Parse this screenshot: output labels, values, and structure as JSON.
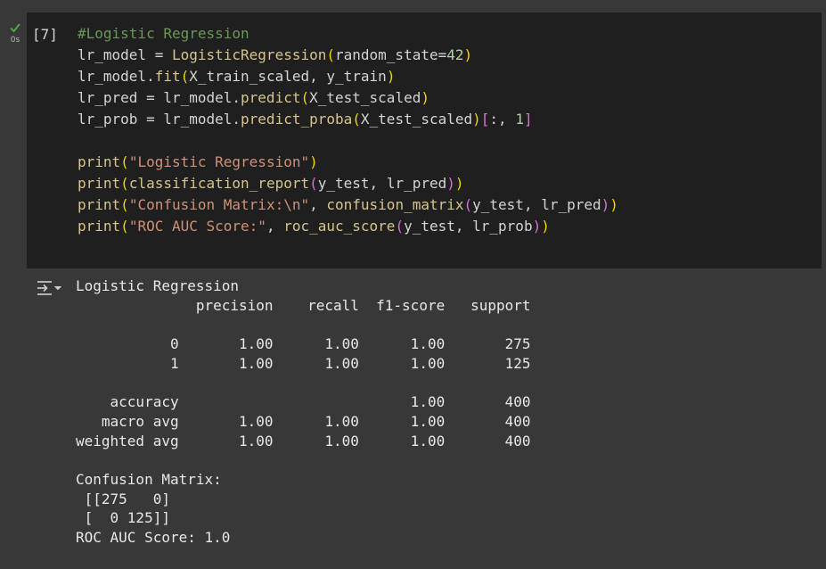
{
  "cell": {
    "status": "success",
    "exec_time": "0s",
    "execution_count": "[7]",
    "status_color": "#4caf50"
  },
  "code_lines": [
    "#Logistic Regression",
    "lr_model = LogisticRegression(random_state=42)",
    "lr_model.fit(X_train_scaled, y_train)",
    "lr_pred = lr_model.predict(X_test_scaled)",
    "lr_prob = lr_model.predict_proba(X_test_scaled)[:, 1]",
    "",
    "print(\"Logistic Regression\")",
    "print(classification_report(y_test, lr_pred))",
    "print(\"Confusion Matrix:\\n\", confusion_matrix(y_test, lr_pred))",
    "print(\"ROC AUC Score:\", roc_auc_score(y_test, lr_prob))"
  ],
  "output": {
    "icon": "output-toggle-icon",
    "lines": [
      "Logistic Regression",
      "              precision    recall  f1-score   support",
      "",
      "           0       1.00      1.00      1.00       275",
      "           1       1.00      1.00      1.00       125",
      "",
      "    accuracy                           1.00       400",
      "   macro avg       1.00      1.00      1.00       400",
      "weighted avg       1.00      1.00      1.00       400",
      "",
      "Confusion Matrix:",
      " [[275   0]",
      " [  0 125]]",
      "ROC AUC Score: 1.0"
    ]
  },
  "colors": {
    "page_bg": "#383838",
    "code_bg": "#1f1f1f",
    "comment": "#6a9955",
    "function": "#d7c48a",
    "string": "#ce9178",
    "number": "#b5cea8",
    "paren": "#f1d700",
    "bracket": "#da70d6"
  }
}
